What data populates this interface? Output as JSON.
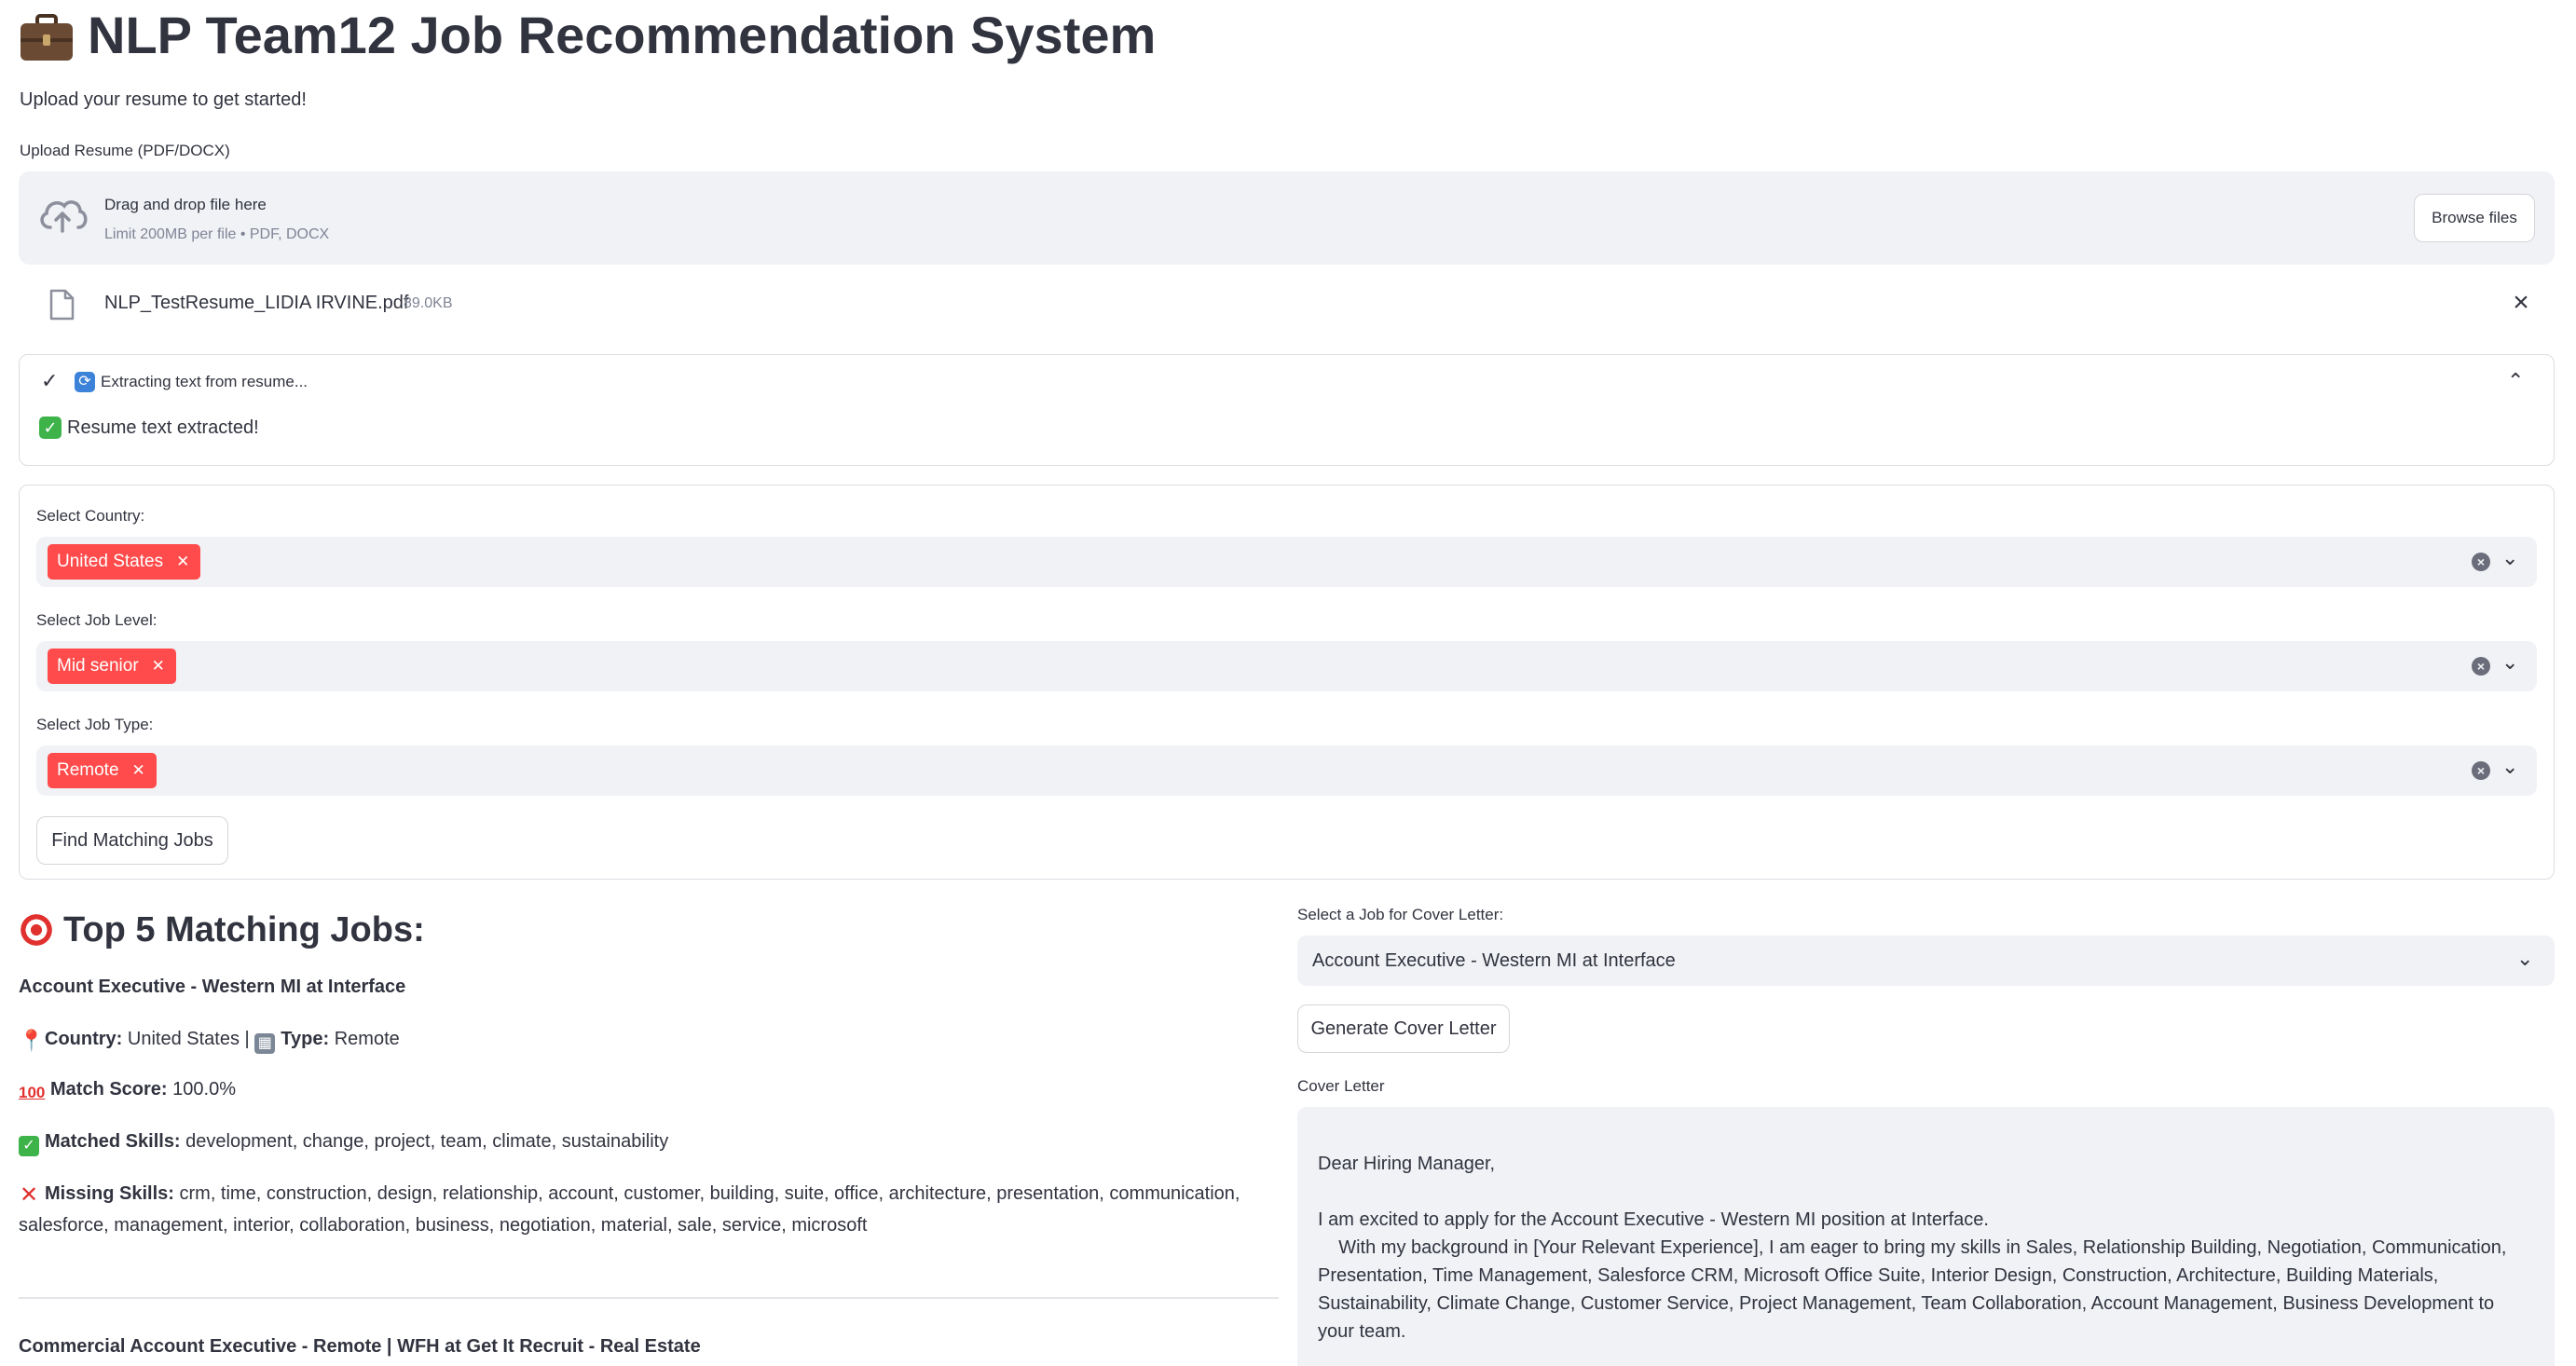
{
  "header": {
    "title": "NLP Team12 Job Recommendation System",
    "title_icon": "briefcase-icon",
    "subtitle": "Upload your resume to get started!"
  },
  "uploader": {
    "label": "Upload Resume (PDF/DOCX)",
    "drop_text": "Drag and drop file here",
    "limit_text": "Limit 200MB per file • PDF, DOCX",
    "browse_label": "Browse files",
    "file_name": "NLP_TestResume_LIDIA IRVINE.pdf",
    "file_size": "89.0KB"
  },
  "status": {
    "step_text": "Extracting text from resume...",
    "success_text": "Resume text extracted!"
  },
  "filters": {
    "country_label": "Select Country:",
    "country_value": "United States",
    "level_label": "Select Job Level:",
    "level_value": "Mid senior",
    "type_label": "Select Job Type:",
    "type_value": "Remote",
    "find_button": "Find Matching Jobs"
  },
  "results": {
    "heading": "Top 5 Matching Jobs:",
    "jobs": [
      {
        "title": "Account Executive - Western MI at Interface",
        "country_label": "Country:",
        "country": "United States",
        "separator": "|",
        "type_label": "Type:",
        "type": "Remote",
        "score_label": "Match Score:",
        "score": "100.0%",
        "matched_label": "Matched Skills:",
        "matched": "development, change, project, team, climate, sustainability",
        "missing_label": "Missing Skills:",
        "missing": "crm, time, construction, design, relationship, account, customer, building, suite, office, architecture, presentation, communication, salesforce, management, interior, collaboration, business, negotiation, material, sale, service, microsoft"
      },
      {
        "title": "Commercial Account Executive - Remote | WFH at Get It Recruit - Real Estate"
      }
    ]
  },
  "cover": {
    "select_label": "Select a Job for Cover Letter:",
    "selected_job": "Account Executive - Western MI at Interface",
    "generate_button": "Generate Cover Letter",
    "letter_label": "Cover Letter",
    "letter_text": "Dear Hiring Manager,\n\nI am excited to apply for the Account Executive - Western MI position at Interface.\n    With my background in [Your Relevant Experience], I am eager to bring my skills in Sales, Relationship Building, Negotiation, Communication, Presentation, Time Management, Salesforce CRM, Microsoft Office Suite, Interior Design, Construction, Architecture, Building Materials, Sustainability, Climate Change, Customer Service, Project Management, Team Collaboration, Account Management, Business Development to your team."
  },
  "colors": {
    "tag": "#ff4b4b",
    "input_bg": "#f0f2f6",
    "text": "#31333f"
  }
}
